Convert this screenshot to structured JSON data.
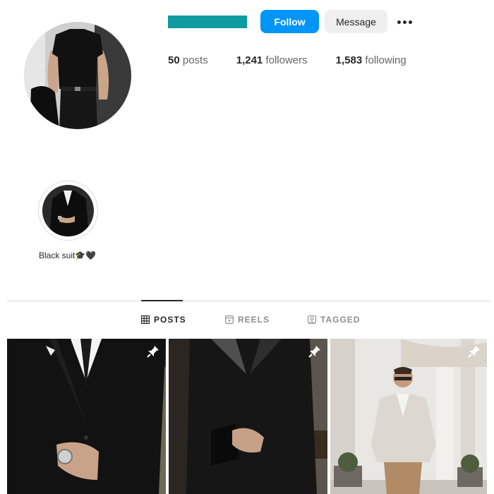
{
  "profile": {
    "actions": {
      "follow_label": "Follow",
      "message_label": "Message",
      "more_icon": "more-horizontal-icon"
    },
    "stats": {
      "posts_count": "50",
      "posts_label": "posts",
      "followers_count": "1,241",
      "followers_label": "followers",
      "following_count": "1,583",
      "following_label": "following"
    }
  },
  "highlights": [
    {
      "label": "Black suit🎓🖤"
    }
  ],
  "tabs": [
    {
      "label": "POSTS",
      "icon": "grid-icon",
      "active": true
    },
    {
      "label": "REELS",
      "icon": "reels-icon",
      "active": false
    },
    {
      "label": "TAGGED",
      "icon": "tagged-icon",
      "active": false
    }
  ],
  "posts": [
    {
      "pinned": true,
      "icon": "pin-icon"
    },
    {
      "pinned": true,
      "icon": "pin-icon"
    },
    {
      "pinned": true,
      "icon": "pin-icon"
    }
  ],
  "colors": {
    "accent": "#0095f6",
    "username_redaction": "#0f9c9f",
    "divider": "#dbdbdb",
    "muted_text": "#8e8e8e"
  }
}
